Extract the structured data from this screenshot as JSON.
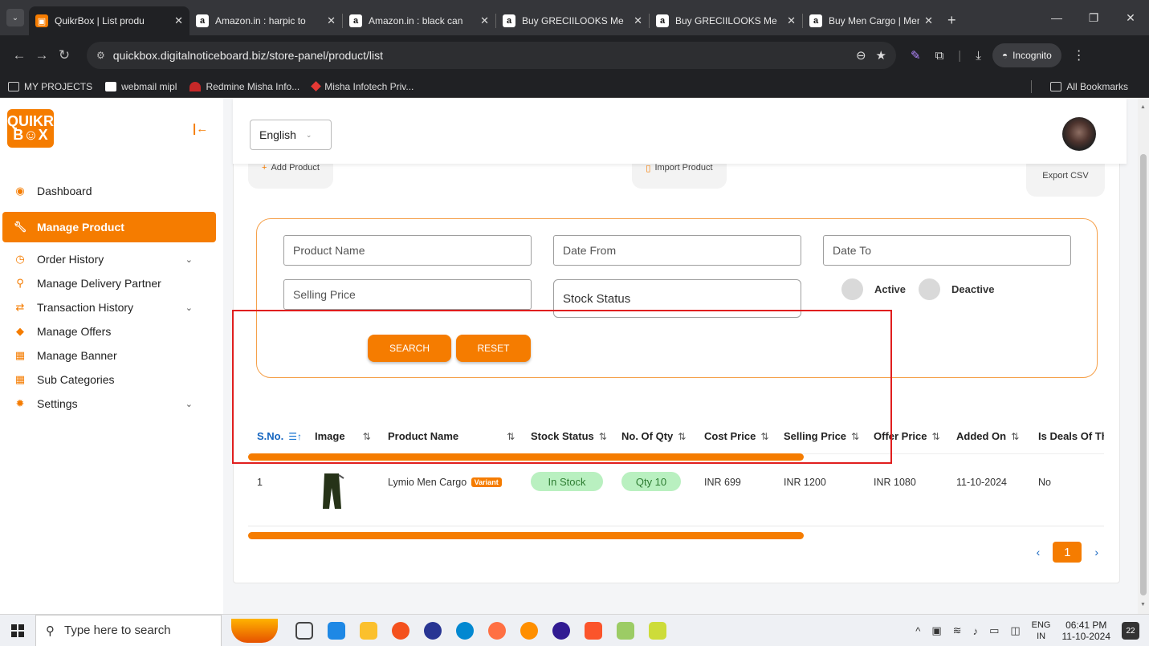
{
  "browser": {
    "tabs": [
      {
        "title": "QuikrBox | List produ",
        "favicon": "quikrbox-favicon",
        "active": true
      },
      {
        "title": "Amazon.in : harpic to",
        "favicon": "amazon-favicon",
        "active": false
      },
      {
        "title": "Amazon.in : black can",
        "favicon": "amazon-favicon",
        "active": false
      },
      {
        "title": "Buy GRECIILOOKS Me",
        "favicon": "amazon-favicon",
        "active": false
      },
      {
        "title": "Buy GRECIILOOKS Me",
        "favicon": "amazon-favicon",
        "active": false
      },
      {
        "title": "Buy Men Cargo | Mer",
        "favicon": "amazon-favicon",
        "active": false
      }
    ],
    "url": "quickbox.digitalnoticeboard.biz/store-panel/product/list",
    "incognito_label": "Incognito",
    "bookmarks": [
      {
        "label": "MY PROJECTS",
        "icon": "folder-icon"
      },
      {
        "label": "webmail mipl",
        "icon": "mail-icon"
      },
      {
        "label": "Redmine Misha Info...",
        "icon": "redmine-icon"
      },
      {
        "label": "Misha Infotech Priv...",
        "icon": "misha-icon"
      }
    ],
    "all_bookmarks_label": "All Bookmarks"
  },
  "app": {
    "logo_text": "QUIKR BOX",
    "language": "English",
    "sidebar": {
      "items": [
        {
          "label": "Dashboard",
          "icon": "dashboard-icon",
          "active": false,
          "expandable": false
        },
        {
          "label": "Manage Product",
          "icon": "wrench-icon",
          "active": true,
          "expandable": false
        },
        {
          "label": "Order History",
          "icon": "clock-icon",
          "active": false,
          "expandable": true
        },
        {
          "label": "Manage Delivery Partner",
          "icon": "motorbike-icon",
          "active": false,
          "expandable": false
        },
        {
          "label": "Transaction History",
          "icon": "transfer-icon",
          "active": false,
          "expandable": true
        },
        {
          "label": "Manage Offers",
          "icon": "tag-icon",
          "active": false,
          "expandable": false
        },
        {
          "label": "Manage Banner",
          "icon": "calendar-icon",
          "active": false,
          "expandable": false
        },
        {
          "label": "Sub Categories",
          "icon": "calendar-icon",
          "active": false,
          "expandable": false
        },
        {
          "label": "Settings",
          "icon": "gear-icon",
          "active": false,
          "expandable": true
        }
      ]
    },
    "actions": {
      "add_product": "Add Product",
      "import_product": "Import Product",
      "export_csv": "Export CSV"
    },
    "filters": {
      "product_name_placeholder": "Product Name",
      "date_from_placeholder": "Date From",
      "date_to_placeholder": "Date To",
      "selling_price_placeholder": "Selling Price",
      "stock_status": "Stock Status",
      "active_label": "Active",
      "deactive_label": "Deactive",
      "search_button": "SEARCH",
      "reset_button": "RESET"
    },
    "table": {
      "columns": [
        "S.No.",
        "Image",
        "Product Name",
        "Stock Status",
        "No. Of Qty",
        "Cost Price",
        "Selling Price",
        "Offer Price",
        "Added On",
        "Is Deals Of Th"
      ],
      "rows": [
        {
          "sno": "1",
          "product_name": "Lymio Men Cargo",
          "variant_badge": "Variant",
          "stock_status": "In Stock",
          "qty": "Qty 10",
          "cost_price": "INR 699",
          "selling_price": "INR 1200",
          "offer_price": "INR 1080",
          "added_on": "11-10-2024",
          "is_deal": "No"
        }
      ]
    },
    "pagination": {
      "prev": "‹",
      "current": "1",
      "next": "›"
    }
  },
  "taskbar": {
    "search_placeholder": "Type here to search",
    "language_line1": "ENG",
    "language_line2": "IN",
    "time": "06:41 PM",
    "date": "11-10-2024",
    "notifications": "22"
  },
  "colors": {
    "accent": "#f57c00",
    "highlight_box": "#e01e1e",
    "in_stock_bg": "#b9f0c0"
  }
}
